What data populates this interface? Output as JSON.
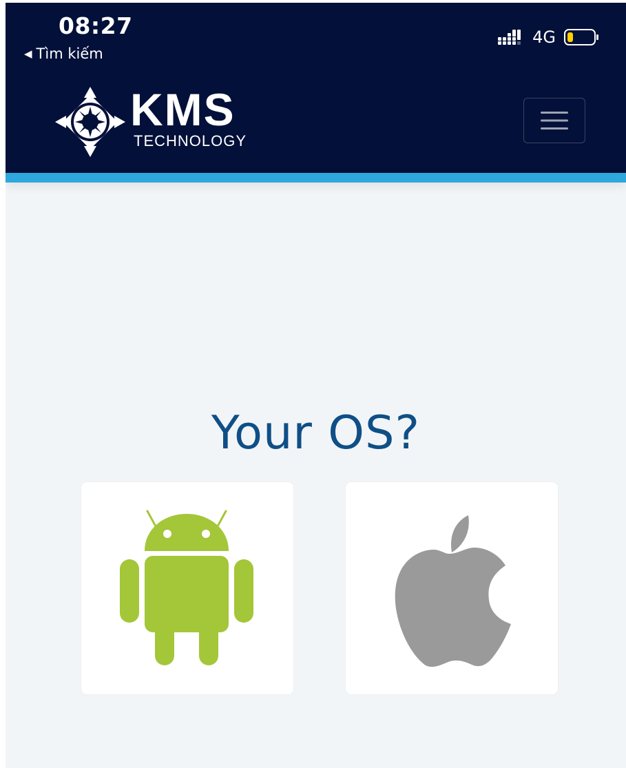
{
  "status_bar": {
    "time": "08:27",
    "back_label": "Tìm kiếm",
    "network": "4G",
    "icons": [
      "back-arrow-icon",
      "signal-icon",
      "battery-icon"
    ],
    "battery_color": "#ffd000"
  },
  "header": {
    "logo_main": "KMS",
    "logo_sub": "TECHNOLOGY",
    "menu_icon": "hamburger-menu-icon",
    "background_color": "#031039",
    "accent_color": "#2ea8dc"
  },
  "main": {
    "title": "Your OS?",
    "options": [
      {
        "name": "Android",
        "icon": "android-icon",
        "color": "#a4c639"
      },
      {
        "name": "iOS",
        "icon": "apple-icon",
        "color": "#9a9a9a"
      }
    ]
  }
}
